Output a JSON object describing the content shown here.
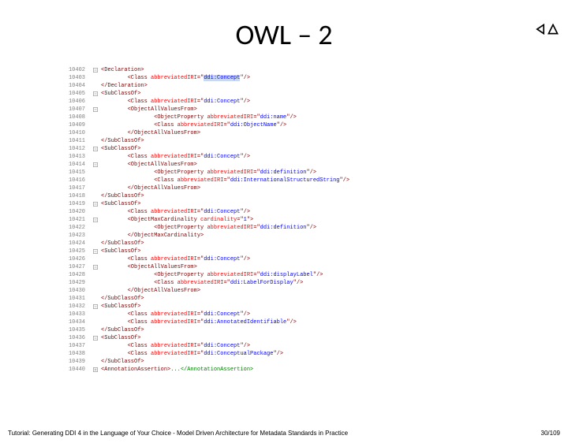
{
  "title": "OWL – 2",
  "footer": {
    "left": "Tutorial: Generating DDI 4 in the Language of Your Choice - Model Driven Architecture for Metadata Standards in Practice",
    "right": "30/109"
  },
  "nav": {
    "prev": "prev",
    "next": "next"
  },
  "code": [
    {
      "n": "10402",
      "g": "-",
      "i": 0,
      "p": [
        {
          "c": "t-tag",
          "t": "<Declaration>"
        }
      ]
    },
    {
      "n": "10403",
      "g": "",
      "i": 2,
      "p": [
        {
          "c": "t-tag",
          "t": "<Class "
        },
        {
          "c": "t-attr",
          "t": "abbreviatedIRI"
        },
        {
          "c": "t-tag",
          "t": "=\""
        },
        {
          "c": "t-val t-hl",
          "t": "ddi:Concept"
        },
        {
          "c": "t-tag",
          "t": "\"/>"
        }
      ]
    },
    {
      "n": "10404",
      "g": "",
      "i": 0,
      "p": [
        {
          "c": "t-tag",
          "t": "</Declaration>"
        }
      ]
    },
    {
      "n": "10405",
      "g": "-",
      "i": 0,
      "p": [
        {
          "c": "t-tag",
          "t": "<SubClassOf>"
        }
      ]
    },
    {
      "n": "10406",
      "g": "",
      "i": 2,
      "p": [
        {
          "c": "t-tag",
          "t": "<Class "
        },
        {
          "c": "t-attr",
          "t": "abbreviatedIRI"
        },
        {
          "c": "t-tag",
          "t": "=\""
        },
        {
          "c": "t-val",
          "t": "ddi:Concept"
        },
        {
          "c": "t-tag",
          "t": "\"/>"
        }
      ]
    },
    {
      "n": "10407",
      "g": "-",
      "i": 2,
      "p": [
        {
          "c": "t-tag",
          "t": "<ObjectAllValuesFrom>"
        }
      ]
    },
    {
      "n": "10408",
      "g": "",
      "i": 4,
      "p": [
        {
          "c": "t-tag",
          "t": "<ObjectProperty "
        },
        {
          "c": "t-attr",
          "t": "abbreviatedIRI"
        },
        {
          "c": "t-tag",
          "t": "=\""
        },
        {
          "c": "t-val",
          "t": "ddi:name"
        },
        {
          "c": "t-tag",
          "t": "\"/>"
        }
      ]
    },
    {
      "n": "10409",
      "g": "",
      "i": 4,
      "p": [
        {
          "c": "t-tag",
          "t": "<Class "
        },
        {
          "c": "t-attr",
          "t": "abbreviatedIRI"
        },
        {
          "c": "t-tag",
          "t": "=\""
        },
        {
          "c": "t-val",
          "t": "ddi:ObjectName"
        },
        {
          "c": "t-tag",
          "t": "\"/>"
        }
      ]
    },
    {
      "n": "10410",
      "g": "",
      "i": 2,
      "p": [
        {
          "c": "t-tag",
          "t": "</ObjectAllValuesFrom>"
        }
      ]
    },
    {
      "n": "10411",
      "g": "",
      "i": 0,
      "p": [
        {
          "c": "t-tag",
          "t": "</SubClassOf>"
        }
      ]
    },
    {
      "n": "10412",
      "g": "-",
      "i": 0,
      "p": [
        {
          "c": "t-tag",
          "t": "<SubClassOf>"
        }
      ]
    },
    {
      "n": "10413",
      "g": "",
      "i": 2,
      "p": [
        {
          "c": "t-tag",
          "t": "<Class "
        },
        {
          "c": "t-attr",
          "t": "abbreviatedIRI"
        },
        {
          "c": "t-tag",
          "t": "=\""
        },
        {
          "c": "t-val",
          "t": "ddi:Concept"
        },
        {
          "c": "t-tag",
          "t": "\"/>"
        }
      ]
    },
    {
      "n": "10414",
      "g": "-",
      "i": 2,
      "p": [
        {
          "c": "t-tag",
          "t": "<ObjectAllValuesFrom>"
        }
      ]
    },
    {
      "n": "10415",
      "g": "",
      "i": 4,
      "p": [
        {
          "c": "t-tag",
          "t": "<ObjectProperty "
        },
        {
          "c": "t-attr",
          "t": "abbreviatedIRI"
        },
        {
          "c": "t-tag",
          "t": "=\""
        },
        {
          "c": "t-val",
          "t": "ddi:definition"
        },
        {
          "c": "t-tag",
          "t": "\"/>"
        }
      ]
    },
    {
      "n": "10416",
      "g": "",
      "i": 4,
      "p": [
        {
          "c": "t-tag",
          "t": "<Class "
        },
        {
          "c": "t-attr",
          "t": "abbreviatedIRI"
        },
        {
          "c": "t-tag",
          "t": "=\""
        },
        {
          "c": "t-val",
          "t": "ddi:InternationalStructuredString"
        },
        {
          "c": "t-tag",
          "t": "\"/>"
        }
      ]
    },
    {
      "n": "10417",
      "g": "",
      "i": 2,
      "p": [
        {
          "c": "t-tag",
          "t": "</ObjectAllValuesFrom>"
        }
      ]
    },
    {
      "n": "10418",
      "g": "",
      "i": 0,
      "p": [
        {
          "c": "t-tag",
          "t": "</SubClassOf>"
        }
      ]
    },
    {
      "n": "10419",
      "g": "-",
      "i": 0,
      "p": [
        {
          "c": "t-tag",
          "t": "<SubClassOf>"
        }
      ]
    },
    {
      "n": "10420",
      "g": "",
      "i": 2,
      "p": [
        {
          "c": "t-tag",
          "t": "<Class "
        },
        {
          "c": "t-attr",
          "t": "abbreviatedIRI"
        },
        {
          "c": "t-tag",
          "t": "=\""
        },
        {
          "c": "t-val",
          "t": "ddi:Concept"
        },
        {
          "c": "t-tag",
          "t": "\"/>"
        }
      ]
    },
    {
      "n": "10421",
      "g": "-",
      "i": 2,
      "p": [
        {
          "c": "t-tag",
          "t": "<ObjectMaxCardinality "
        },
        {
          "c": "t-attr",
          "t": "cardinality"
        },
        {
          "c": "t-tag",
          "t": "=\""
        },
        {
          "c": "t-val",
          "t": "1"
        },
        {
          "c": "t-tag",
          "t": "\">"
        }
      ]
    },
    {
      "n": "10422",
      "g": "",
      "i": 4,
      "p": [
        {
          "c": "t-tag",
          "t": "<ObjectProperty "
        },
        {
          "c": "t-attr",
          "t": "abbreviatedIRI"
        },
        {
          "c": "t-tag",
          "t": "=\""
        },
        {
          "c": "t-val",
          "t": "ddi:definition"
        },
        {
          "c": "t-tag",
          "t": "\"/>"
        }
      ]
    },
    {
      "n": "10423",
      "g": "",
      "i": 2,
      "p": [
        {
          "c": "t-tag",
          "t": "</ObjectMaxCardinality>"
        }
      ]
    },
    {
      "n": "10424",
      "g": "",
      "i": 0,
      "p": [
        {
          "c": "t-tag",
          "t": "</SubClassOf>"
        }
      ]
    },
    {
      "n": "10425",
      "g": "-",
      "i": 0,
      "p": [
        {
          "c": "t-tag",
          "t": "<SubClassOf>"
        }
      ]
    },
    {
      "n": "10426",
      "g": "",
      "i": 2,
      "p": [
        {
          "c": "t-tag",
          "t": "<Class "
        },
        {
          "c": "t-attr",
          "t": "abbreviatedIRI"
        },
        {
          "c": "t-tag",
          "t": "=\""
        },
        {
          "c": "t-val",
          "t": "ddi:Concept"
        },
        {
          "c": "t-tag",
          "t": "\"/>"
        }
      ]
    },
    {
      "n": "10427",
      "g": "-",
      "i": 2,
      "p": [
        {
          "c": "t-tag",
          "t": "<ObjectAllValuesFrom>"
        }
      ]
    },
    {
      "n": "10428",
      "g": "",
      "i": 4,
      "p": [
        {
          "c": "t-tag",
          "t": "<ObjectProperty "
        },
        {
          "c": "t-attr",
          "t": "abbreviatedIRI"
        },
        {
          "c": "t-tag",
          "t": "=\""
        },
        {
          "c": "t-val",
          "t": "ddi:displayLabel"
        },
        {
          "c": "t-tag",
          "t": "\"/>"
        }
      ]
    },
    {
      "n": "10429",
      "g": "",
      "i": 4,
      "p": [
        {
          "c": "t-tag",
          "t": "<Class "
        },
        {
          "c": "t-attr",
          "t": "abbreviatedIRI"
        },
        {
          "c": "t-tag",
          "t": "=\""
        },
        {
          "c": "t-val",
          "t": "ddi:LabelForDisplay"
        },
        {
          "c": "t-tag",
          "t": "\"/>"
        }
      ]
    },
    {
      "n": "10430",
      "g": "",
      "i": 2,
      "p": [
        {
          "c": "t-tag",
          "t": "</ObjectAllValuesFrom>"
        }
      ]
    },
    {
      "n": "10431",
      "g": "",
      "i": 0,
      "p": [
        {
          "c": "t-tag",
          "t": "</SubClassOf>"
        }
      ]
    },
    {
      "n": "10432",
      "g": "-",
      "i": 0,
      "p": [
        {
          "c": "t-tag",
          "t": "<SubClassOf>"
        }
      ]
    },
    {
      "n": "10433",
      "g": "",
      "i": 2,
      "p": [
        {
          "c": "t-tag",
          "t": "<Class "
        },
        {
          "c": "t-attr",
          "t": "abbreviatedIRI"
        },
        {
          "c": "t-tag",
          "t": "=\""
        },
        {
          "c": "t-val",
          "t": "ddi:Concept"
        },
        {
          "c": "t-tag",
          "t": "\"/>"
        }
      ]
    },
    {
      "n": "10434",
      "g": "",
      "i": 2,
      "p": [
        {
          "c": "t-tag",
          "t": "<Class "
        },
        {
          "c": "t-attr",
          "t": "abbreviatedIRI"
        },
        {
          "c": "t-tag",
          "t": "=\""
        },
        {
          "c": "t-val",
          "t": "ddi:AnnotatedIdentifiable"
        },
        {
          "c": "t-tag",
          "t": "\"/>"
        }
      ]
    },
    {
      "n": "10435",
      "g": "",
      "i": 0,
      "p": [
        {
          "c": "t-tag",
          "t": "</SubClassOf>"
        }
      ]
    },
    {
      "n": "10436",
      "g": "-",
      "i": 0,
      "p": [
        {
          "c": "t-tag",
          "t": "<SubClassOf>"
        }
      ]
    },
    {
      "n": "10437",
      "g": "",
      "i": 2,
      "p": [
        {
          "c": "t-tag",
          "t": "<Class "
        },
        {
          "c": "t-attr",
          "t": "abbreviatedIRI"
        },
        {
          "c": "t-tag",
          "t": "=\""
        },
        {
          "c": "t-val",
          "t": "ddi:Concept"
        },
        {
          "c": "t-tag",
          "t": "\"/>"
        }
      ]
    },
    {
      "n": "10438",
      "g": "",
      "i": 2,
      "p": [
        {
          "c": "t-tag",
          "t": "<Class "
        },
        {
          "c": "t-attr",
          "t": "abbreviatedIRI"
        },
        {
          "c": "t-tag",
          "t": "=\""
        },
        {
          "c": "t-val",
          "t": "ddi:ConceptualPackage"
        },
        {
          "c": "t-tag",
          "t": "\"/>"
        }
      ]
    },
    {
      "n": "10439",
      "g": "",
      "i": 0,
      "p": [
        {
          "c": "t-tag",
          "t": "</SubClassOf>"
        }
      ]
    },
    {
      "n": "10440",
      "g": "+",
      "i": 0,
      "p": [
        {
          "c": "t-tag",
          "t": "<AnnotationAssertion>"
        },
        {
          "c": "t-cmt",
          "t": "...</AnnotationAssertion>"
        }
      ]
    }
  ]
}
